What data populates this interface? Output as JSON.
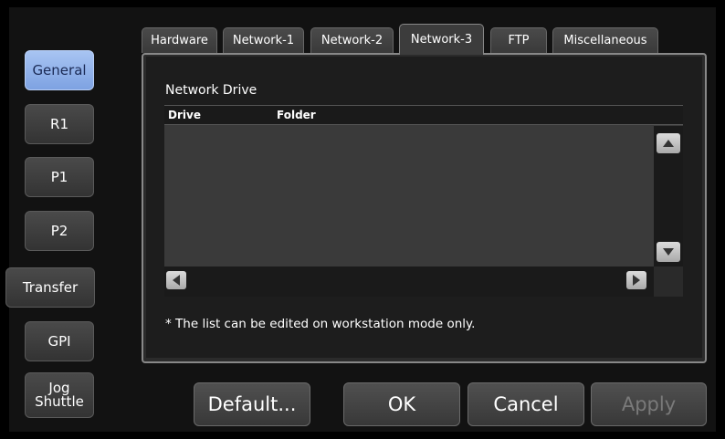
{
  "sidebar": {
    "items": [
      {
        "label": "General",
        "active": true
      },
      {
        "label": "R1"
      },
      {
        "label": "P1"
      },
      {
        "label": "P2"
      },
      {
        "label": "Transfer"
      },
      {
        "label": "GPI"
      },
      {
        "label": "Jog\nShuttle"
      }
    ]
  },
  "tabs": [
    {
      "label": "Hardware"
    },
    {
      "label": "Network-1"
    },
    {
      "label": "Network-2"
    },
    {
      "label": "Network-3",
      "active": true
    },
    {
      "label": "FTP"
    },
    {
      "label": "Miscellaneous"
    }
  ],
  "section": {
    "title": "Network Drive",
    "columns": [
      "Drive",
      "Folder"
    ],
    "rows": []
  },
  "note": "* The list can be edited on workstation mode only.",
  "buttons": {
    "default": "Default...",
    "ok": "OK",
    "cancel": "Cancel",
    "apply": "Apply"
  },
  "colors": {
    "active_side": "#8fb0ec",
    "panel_border": "#888888"
  }
}
